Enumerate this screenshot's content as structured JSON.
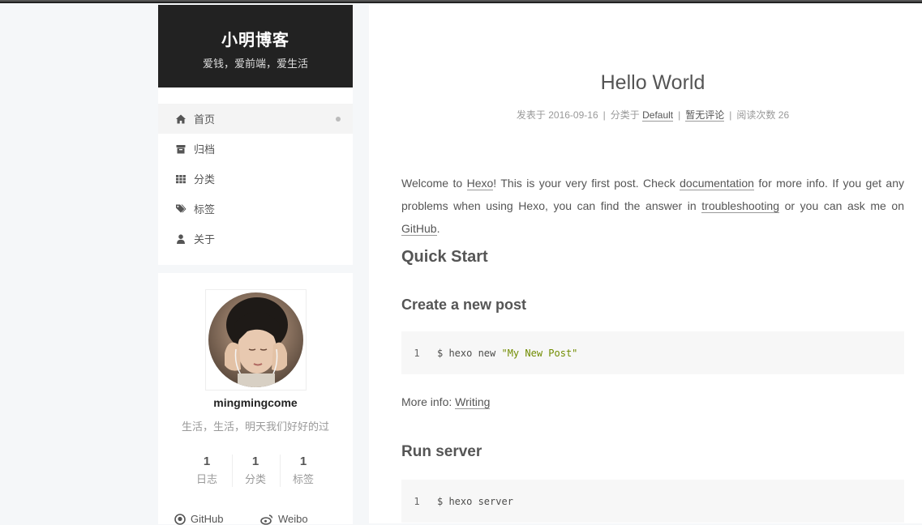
{
  "site": {
    "title": "小明博客",
    "subtitle": "爱钱，爱前端，爱生活"
  },
  "menu": [
    {
      "label": "首页",
      "icon": "home-icon",
      "active": true
    },
    {
      "label": "归档",
      "icon": "archive-icon"
    },
    {
      "label": "分类",
      "icon": "th-icon"
    },
    {
      "label": "标签",
      "icon": "tags-icon"
    },
    {
      "label": "关于",
      "icon": "user-icon"
    }
  ],
  "author": {
    "name": "mingmingcome",
    "description": "生活，生活，明天我们好好的过",
    "stats": [
      {
        "count": "1",
        "label": "日志"
      },
      {
        "count": "1",
        "label": "分类"
      },
      {
        "count": "1",
        "label": "标签"
      }
    ],
    "links": [
      {
        "label": "GitHub",
        "icon": "github-icon"
      },
      {
        "label": "Weibo",
        "icon": "weibo-icon"
      }
    ]
  },
  "post": {
    "title": "Hello World",
    "meta": {
      "posted_label": "发表于",
      "date": "2016-09-16",
      "category_label": "分类于",
      "category": "Default",
      "comments": "暂无评论",
      "views_label": "阅读次数",
      "views": "26"
    },
    "intro": {
      "t1": "Welcome to ",
      "hexo_link": "Hexo",
      "t2": "! This is your very first post. Check ",
      "docs_link": "documentation",
      "t3": " for more info. If you get any problems when using Hexo, you can find the answer in ",
      "troubleshooting_link": "troubleshooting",
      "t4": " or you can ask me on ",
      "github_link": "GitHub",
      "t5": "."
    },
    "quick_start_heading": "Quick Start",
    "create_heading": "Create a new post",
    "code1": {
      "line_no": "1",
      "cmd": "$ hexo new ",
      "arg": "\"My New Post\""
    },
    "more_info_label": "More info: ",
    "writing_link": "Writing",
    "run_heading": "Run server",
    "code2": {
      "line_no": "1",
      "cmd": "$ hexo server"
    }
  },
  "colors": {
    "header_bg": "#222222",
    "page_bg": "#f5f7f9",
    "code_bg": "#f7f7f7",
    "string": "#718c00"
  }
}
